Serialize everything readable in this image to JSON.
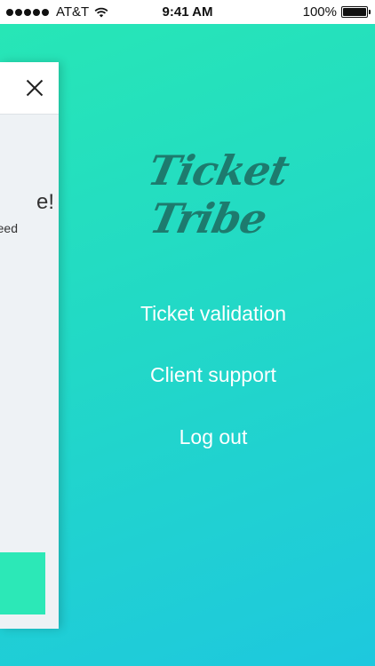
{
  "status_bar": {
    "carrier": "AT&T",
    "time": "9:41 AM",
    "battery": "100%",
    "signal_icon": "signal-dots-icon",
    "wifi_icon": "wifi-icon",
    "battery_icon": "battery-icon"
  },
  "drawer": {
    "close_icon": "close-icon",
    "peek_heading": "e!",
    "peek_subtext": "eed"
  },
  "menu": {
    "logo_text": "Ticket Tribe",
    "items": [
      {
        "label": "Ticket validation"
      },
      {
        "label": "Client support"
      },
      {
        "label": "Log out"
      }
    ]
  },
  "colors": {
    "gradient_top": "#27e6b6",
    "gradient_bottom": "#1ec8de",
    "logo": "#1d7b6e",
    "drawer_button": "#2ce8b7"
  }
}
